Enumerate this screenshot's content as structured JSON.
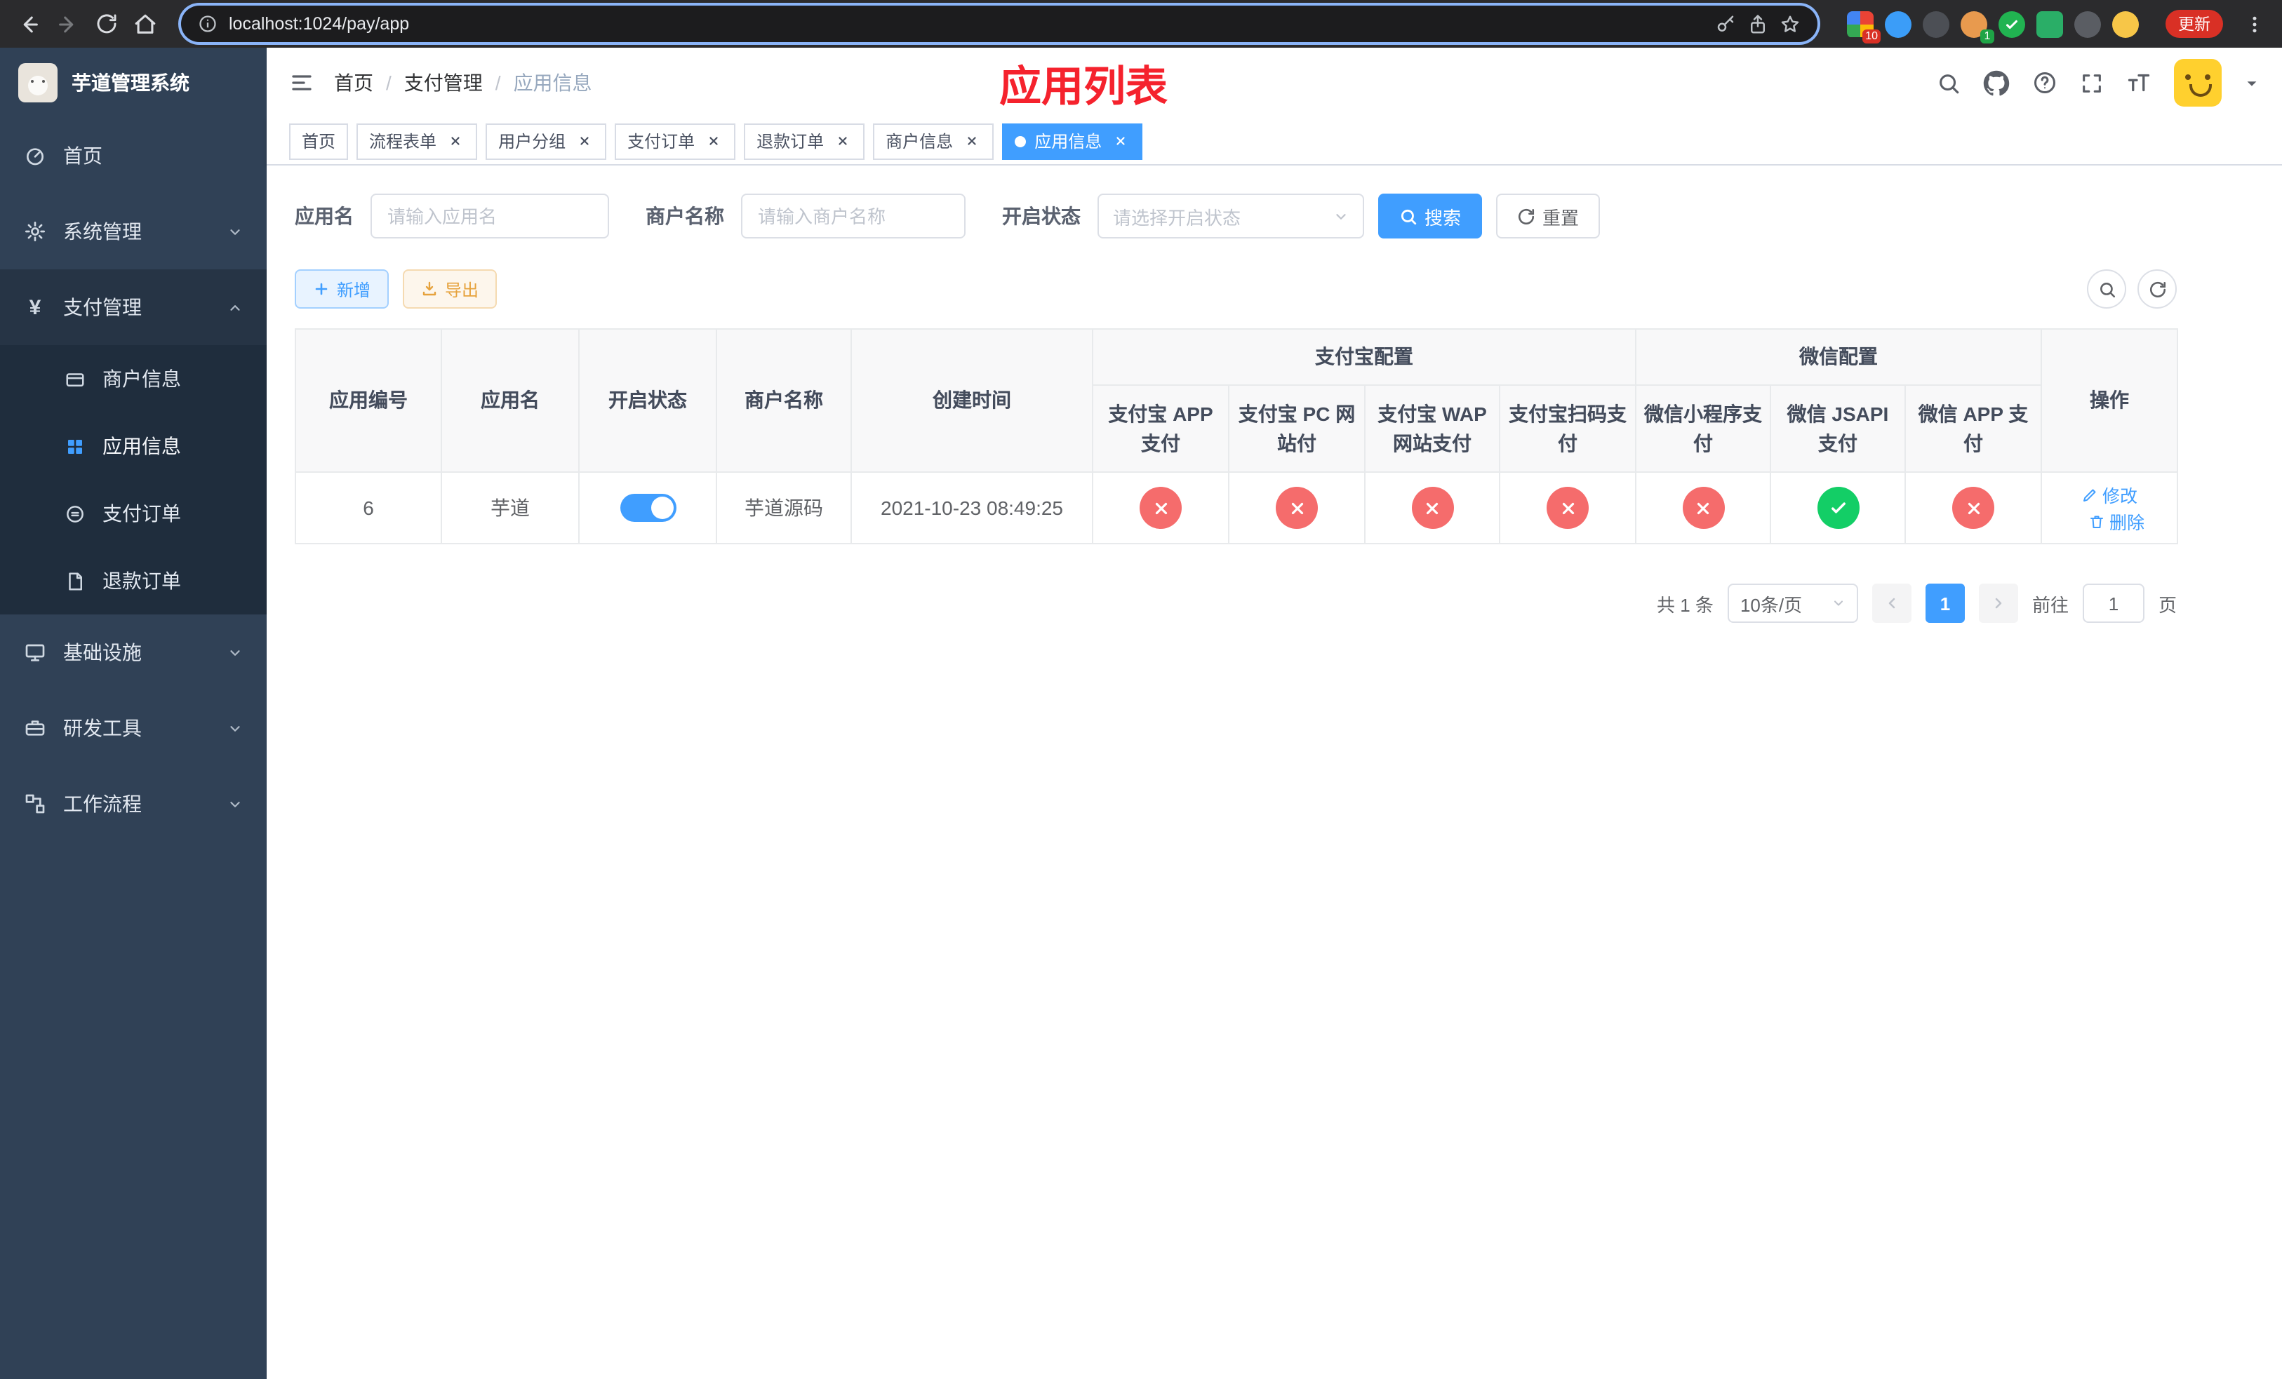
{
  "browser": {
    "url": "localhost:1024/pay/app",
    "update_button": "更新",
    "extension_badge_count": "10",
    "profile_badge_count": "1"
  },
  "sidebar": {
    "app_title": "芋道管理系统",
    "menu": [
      {
        "label": "首页"
      },
      {
        "label": "系统管理"
      },
      {
        "label": "支付管理"
      },
      {
        "label": "基础设施"
      },
      {
        "label": "研发工具"
      },
      {
        "label": "工作流程"
      }
    ],
    "payment_children": [
      {
        "label": "商户信息"
      },
      {
        "label": "应用信息"
      },
      {
        "label": "支付订单"
      },
      {
        "label": "退款订单"
      }
    ]
  },
  "header": {
    "breadcrumb": [
      "首页",
      "支付管理",
      "应用信息"
    ],
    "title": "应用列表"
  },
  "tabs": [
    {
      "label": "首页"
    },
    {
      "label": "流程表单"
    },
    {
      "label": "用户分组"
    },
    {
      "label": "支付订单"
    },
    {
      "label": "退款订单"
    },
    {
      "label": "商户信息"
    },
    {
      "label": "应用信息"
    }
  ],
  "filters": {
    "app_name_label": "应用名",
    "app_name_placeholder": "请输入应用名",
    "merchant_label": "商户名称",
    "merchant_placeholder": "请输入商户名称",
    "status_label": "开启状态",
    "status_placeholder": "请选择开启状态",
    "search_button": "搜索",
    "reset_button": "重置"
  },
  "toolbar": {
    "add_button": "新增",
    "export_button": "导出"
  },
  "table": {
    "group_alipay": "支付宝配置",
    "group_wechat": "微信配置",
    "col_id": "应用编号",
    "col_name": "应用名",
    "col_status": "开启状态",
    "col_merchant": "商户名称",
    "col_created": "创建时间",
    "col_alipay_app": "支付宝 APP 支付",
    "col_alipay_pc": "支付宝 PC 网站付",
    "col_alipay_wap": "支付宝 WAP 网站支付",
    "col_alipay_qr": "支付宝扫码支付",
    "col_wx_mini": "微信小程序支付",
    "col_wx_jsapi": "微信 JSAPI 支付",
    "col_wx_app": "微信 APP 支付",
    "col_actions": "操作",
    "rows": [
      {
        "id": "6",
        "name": "芋道",
        "enabled": true,
        "merchant": "芋道源码",
        "created_at": "2021-10-23 08:49:25",
        "alipay_app": false,
        "alipay_pc": false,
        "alipay_wap": false,
        "alipay_qr": false,
        "wx_mini": false,
        "wx_jsapi": true,
        "wx_app": false,
        "edit_label": "修改",
        "delete_label": "删除"
      }
    ]
  },
  "pagination": {
    "total_text": "共 1 条",
    "page_size_text": "10条/页",
    "current_page": "1",
    "goto_label": "前往",
    "goto_value": "1",
    "page_unit": "页"
  },
  "colors": {
    "accent": "#409eff",
    "sidebar_bg": "#304156",
    "submenu_bg": "#1f2d3d",
    "title_red": "#f5222d",
    "status_no": "#f56c6c",
    "status_ok": "#13ce66",
    "warning": "#e6a23c"
  }
}
